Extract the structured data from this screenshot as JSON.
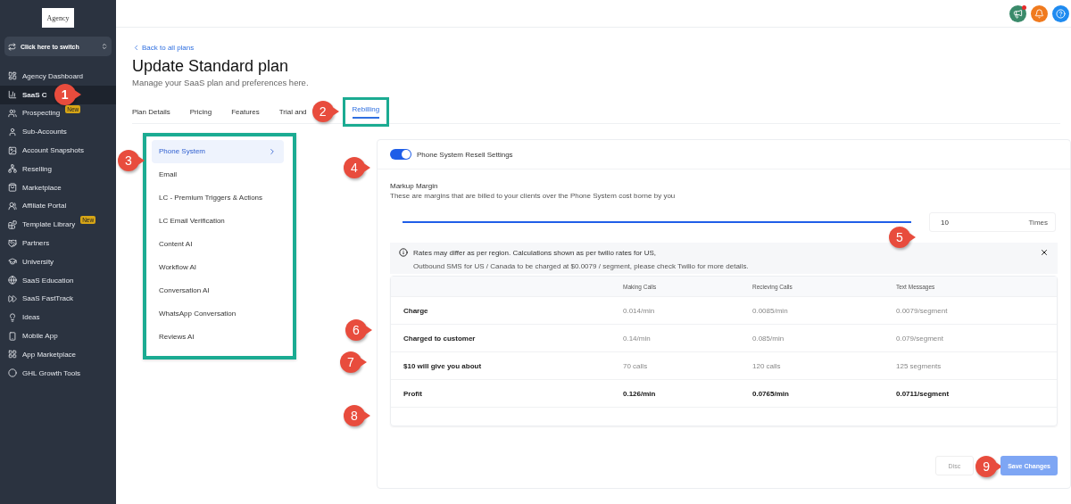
{
  "sidebar": {
    "logo": "Agency",
    "switcher": "Click here to switch",
    "items": [
      {
        "label": "Agency Dashboard",
        "selected": false
      },
      {
        "label": "SaaS C",
        "selected": true
      },
      {
        "label": "Prospecting",
        "selected": false,
        "badge": "New"
      },
      {
        "label": "Sub-Accounts",
        "selected": false
      },
      {
        "label": "Account Snapshots",
        "selected": false
      },
      {
        "label": "Reselling",
        "selected": false
      },
      {
        "label": "Marketplace",
        "selected": false
      },
      {
        "label": "Affiliate Portal",
        "selected": false
      },
      {
        "label": "Template Library",
        "selected": false,
        "badge": "New"
      },
      {
        "label": "Partners",
        "selected": false
      },
      {
        "label": "University",
        "selected": false
      },
      {
        "label": "SaaS Education",
        "selected": false
      },
      {
        "label": "SaaS FastTrack",
        "selected": false
      },
      {
        "label": "Ideas",
        "selected": false
      },
      {
        "label": "Mobile App",
        "selected": false
      },
      {
        "label": "App Marketplace",
        "selected": false
      },
      {
        "label": "GHL Growth Tools",
        "selected": false
      }
    ]
  },
  "topbar": {
    "icons": [
      {
        "color": "#3a8a6a",
        "dot": true
      },
      {
        "color": "#f07a1e",
        "dot": false
      },
      {
        "color": "#1f8bf0",
        "dot": false
      }
    ]
  },
  "back_link": "Back to all plans",
  "title": "Update Standard plan",
  "subtitle": "Manage your SaaS plan and preferences here.",
  "tabs": [
    {
      "label": "Plan Details",
      "selected": false,
      "highlighted": false
    },
    {
      "label": "Pricing",
      "selected": false,
      "highlighted": false
    },
    {
      "label": "Features",
      "selected": false,
      "highlighted": false
    },
    {
      "label": "Trial and",
      "selected": false,
      "highlighted": false
    },
    {
      "label": "Rebilling",
      "selected": true,
      "highlighted": true
    }
  ],
  "side_menu": {
    "highlighted": true,
    "items": [
      {
        "label": "Phone System",
        "selected": true
      },
      {
        "label": "Email",
        "selected": false
      },
      {
        "label": "LC - Premium Triggers & Actions",
        "selected": false
      },
      {
        "label": "LC Email Verification",
        "selected": false
      },
      {
        "label": "Content AI",
        "selected": false
      },
      {
        "label": "Workflow AI",
        "selected": false
      },
      {
        "label": "Conversation AI",
        "selected": false
      },
      {
        "label": "WhatsApp Conversation",
        "selected": false
      },
      {
        "label": "Reviews AI",
        "selected": false
      }
    ]
  },
  "settings": {
    "toggle_label": "Phone System Resell Settings",
    "on": true,
    "markup_title": "Markup Margin",
    "markup_desc": "These are margins that are billed to your clients over the Phone System cost borne by you",
    "slider": {
      "level": 1.0
    },
    "multiplier": "10",
    "unit": "Times",
    "notice": {
      "line1": "Rates may differ as per region. Calculations shown as per twilio rates for US,",
      "line2": "Outbound SMS for US / Canada to be charged at $0.0079 / segment, please check Twilio for more details."
    },
    "table": {
      "columns": [
        "Making Calls",
        "Recieving Calls",
        "Text Messages"
      ],
      "rows": [
        {
          "label": "Charge",
          "cells": [
            "0.014/min",
            "0.0085/min",
            "0.0079/segment"
          ],
          "bold": false
        },
        {
          "label": "Charged to customer",
          "cells": [
            "0.14/min",
            "0.085/min",
            "0.079/segment"
          ],
          "bold": false
        },
        {
          "label": "$10 will give you about",
          "cells": [
            "70 calls",
            "120 calls",
            "125 segments"
          ],
          "bold": false
        },
        {
          "label": "Profit",
          "cells": [
            "0.126/min",
            "0.0765/min",
            "0.0711/segment"
          ],
          "bold": true
        }
      ]
    },
    "discard": "Disc",
    "save": "Save Changes"
  },
  "annotations": [
    "1",
    "2",
    "3",
    "4",
    "5",
    "6",
    "7",
    "8",
    "9"
  ]
}
